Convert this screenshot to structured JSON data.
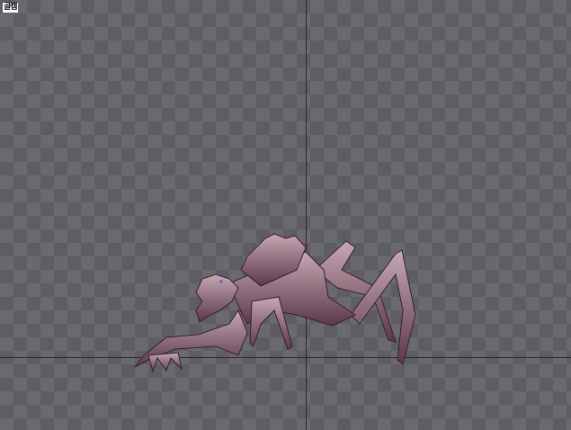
{
  "viewer": {
    "badge_label": "골캠",
    "sprite": "alien-creature",
    "colors": {
      "checker_dark": "#5d5d63",
      "checker_light": "#69696f",
      "axis": "#2a2a30",
      "creature": "#8a6a78"
    }
  }
}
